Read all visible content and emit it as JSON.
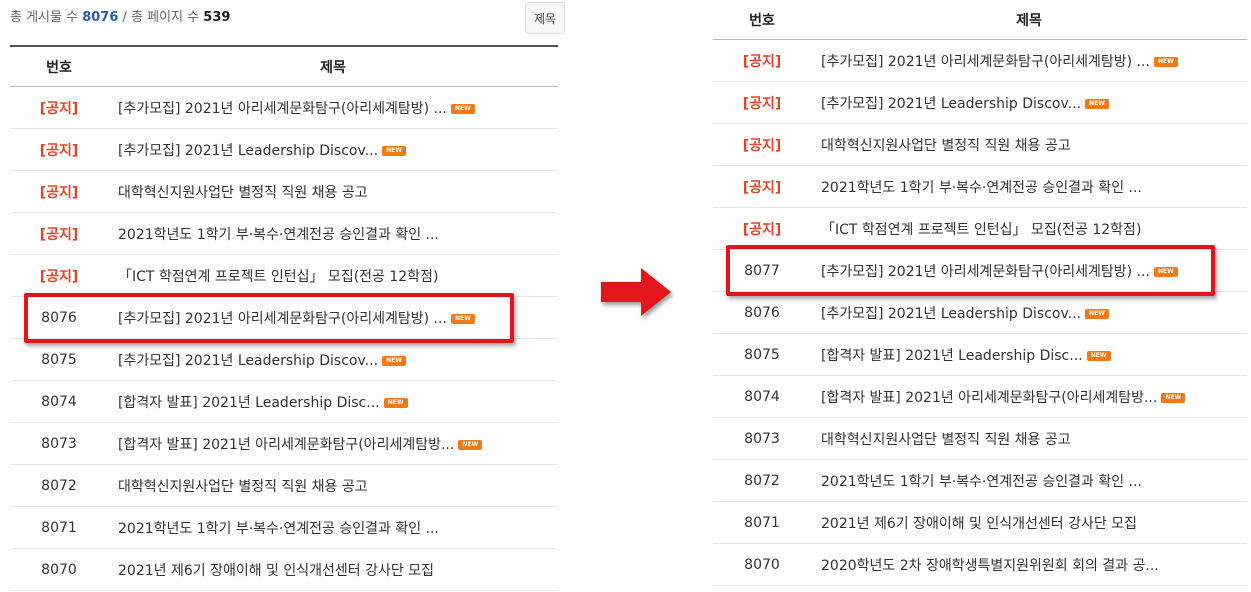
{
  "left": {
    "summary": {
      "posts_label": "총 게시물 수",
      "posts_count": "8076",
      "separator": "/",
      "pages_label": "총 페이지 수",
      "pages_count": "539"
    },
    "search_select": "제목",
    "headers": {
      "num": "번호",
      "title": "제목"
    },
    "rows": [
      {
        "num": "[공지]",
        "notice": true,
        "title": "[추가모집] 2021년 아리세계문화탐구(아리세계탐방) ...",
        "new": true
      },
      {
        "num": "[공지]",
        "notice": true,
        "title": "[추가모집] 2021년 Leadership Discov...",
        "new": true
      },
      {
        "num": "[공지]",
        "notice": true,
        "title": "대학혁신지원사업단 별정직 직원 채용 공고",
        "new": false
      },
      {
        "num": "[공지]",
        "notice": true,
        "title": "2021학년도 1학기 부·복수·연계전공 승인결과 확인 ...",
        "new": false
      },
      {
        "num": "[공지]",
        "notice": true,
        "title": "「ICT 학점연계 프로젝트 인턴십」 모집(전공 12학점)",
        "new": false
      },
      {
        "num": "8076",
        "notice": false,
        "title": "[추가모집] 2021년 아리세계문화탐구(아리세계탐방) ...",
        "new": true
      },
      {
        "num": "8075",
        "notice": false,
        "title": "[추가모집] 2021년 Leadership Discov...",
        "new": true
      },
      {
        "num": "8074",
        "notice": false,
        "title": "[합격자 발표] 2021년 Leadership Disc...",
        "new": true
      },
      {
        "num": "8073",
        "notice": false,
        "title": "[합격자 발표] 2021년 아리세계문화탐구(아리세계탐방...",
        "new": true
      },
      {
        "num": "8072",
        "notice": false,
        "title": "대학혁신지원사업단 별정직 직원 채용 공고",
        "new": false
      },
      {
        "num": "8071",
        "notice": false,
        "title": "2021학년도 1학기 부·복수·연계전공 승인결과 확인 ...",
        "new": false
      },
      {
        "num": "8070",
        "notice": false,
        "title": "2021년 제6기 장애이해 및 인식개선센터 강사단 모집",
        "new": false
      }
    ]
  },
  "right": {
    "headers": {
      "num": "번호",
      "title": "제목"
    },
    "rows": [
      {
        "num": "[공지]",
        "notice": true,
        "title": "[추가모집] 2021년 아리세계문화탐구(아리세계탐방) ...",
        "new": true
      },
      {
        "num": "[공지]",
        "notice": true,
        "title": "[추가모집] 2021년 Leadership Discov...",
        "new": true
      },
      {
        "num": "[공지]",
        "notice": true,
        "title": "대학혁신지원사업단 별정직 직원 채용 공고",
        "new": false
      },
      {
        "num": "[공지]",
        "notice": true,
        "title": "2021학년도 1학기 부·복수·연계전공 승인결과 확인 ...",
        "new": false
      },
      {
        "num": "[공지]",
        "notice": true,
        "title": "「ICT 학점연계 프로젝트 인턴십」 모집(전공 12학점)",
        "new": false
      },
      {
        "num": "8077",
        "notice": false,
        "title": "[추가모집] 2021년 아리세계문화탐구(아리세계탐방) ...",
        "new": true
      },
      {
        "num": "8076",
        "notice": false,
        "title": "[추가모집] 2021년 Leadership Discov...",
        "new": true
      },
      {
        "num": "8075",
        "notice": false,
        "title": "[합격자 발표] 2021년 Leadership Disc...",
        "new": true
      },
      {
        "num": "8074",
        "notice": false,
        "title": "[합격자 발표] 2021년 아리세계문화탐구(아리세계탐방...",
        "new": true
      },
      {
        "num": "8073",
        "notice": false,
        "title": "대학혁신지원사업단 별정직 직원 채용 공고",
        "new": false
      },
      {
        "num": "8072",
        "notice": false,
        "title": "2021학년도 1학기 부·복수·연계전공 승인결과 확인 ...",
        "new": false
      },
      {
        "num": "8071",
        "notice": false,
        "title": "2021년 제6기 장애이해 및 인식개선센터 강사단 모집",
        "new": false
      },
      {
        "num": "8070",
        "notice": false,
        "title": "2020학년도 2차 장애학생특별지원위원회 회의 결과 공...",
        "new": false
      }
    ]
  },
  "new_badge_text": "NEW",
  "colors": {
    "notice": "#e1452a",
    "highlight": "#e3141b",
    "arrow": "#e3141b",
    "new_badge": "#f07a14",
    "count": "#2a5ea8"
  },
  "arrow_icon": "arrow-right-icon"
}
